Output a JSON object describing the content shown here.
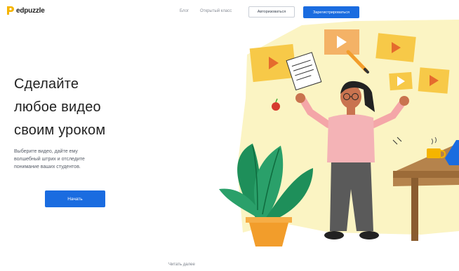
{
  "header": {
    "logo_text": "edpuzzle",
    "nav": {
      "blog": "Блог",
      "open_class": "Открытый класс",
      "login": "Авторизоваться",
      "signup": "Зарегистрироваться"
    }
  },
  "hero": {
    "title_lines": [
      "Сделайте",
      "любое видео",
      "своим уроком"
    ],
    "subtitle_lines": [
      "Выберите видео, дайте ему",
      "волшебный штрих и отследите",
      "понимание ваших студентов."
    ],
    "cta": "Начать"
  },
  "footer": {
    "read_more": "Читать далее"
  },
  "colors": {
    "brand_blue": "#1a6ce0",
    "logo_yellow": "#f5b400",
    "illustration_bg": "#fbf4c3",
    "video_card": "#f7c948"
  }
}
